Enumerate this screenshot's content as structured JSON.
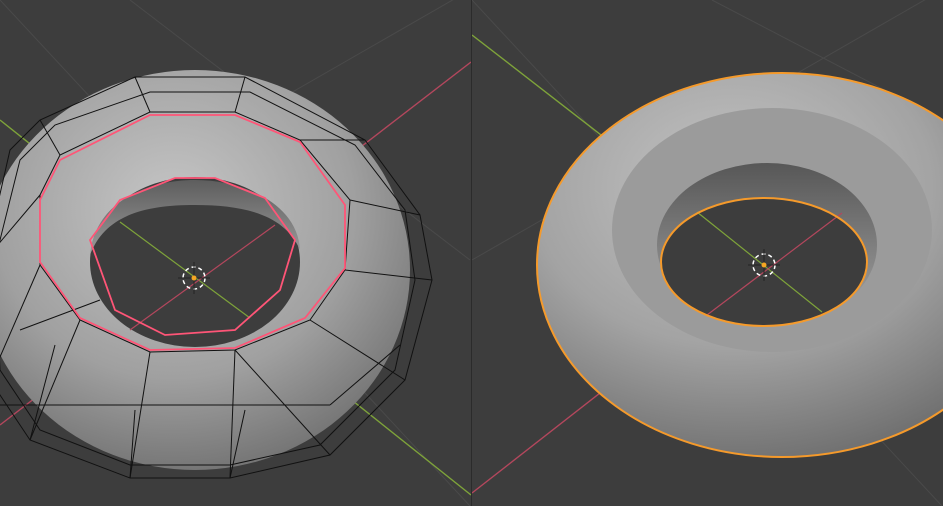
{
  "colors": {
    "background": "#3d3d3d",
    "grid_line": "#4a4a4a",
    "x_axis": "#b3475d",
    "y_axis": "#7ea33a",
    "mesh_fill_light": "#b4b4b4",
    "mesh_fill_dark": "#6a6a6a",
    "wireframe": "#111111",
    "selected_edge": "#ff5577",
    "object_outline": "#f59a2b",
    "origin_dot": "#f5a623",
    "cursor": "#ffffff"
  },
  "viewports": [
    {
      "mode": "edit-mode",
      "object": "torus",
      "shading": "solid"
    },
    {
      "mode": "object-mode",
      "object": "torus",
      "shading": "solid",
      "selected": true
    }
  ]
}
